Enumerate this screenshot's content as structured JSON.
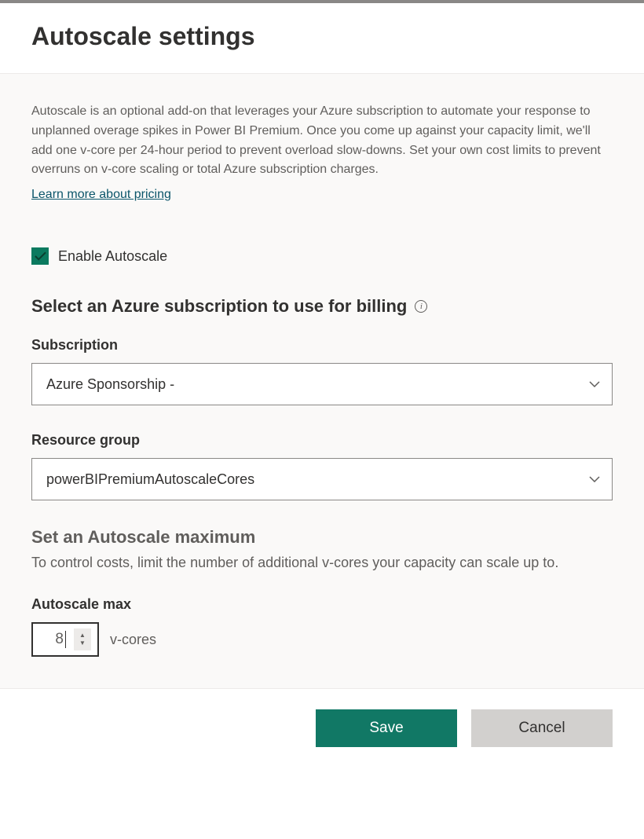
{
  "header": {
    "title": "Autoscale settings"
  },
  "main": {
    "description": "Autoscale is an optional add-on that leverages your Azure subscription to automate your response to unplanned overage spikes in Power BI Premium. Once you come up against your capacity limit, we'll add one v-core per 24-hour period to prevent overload slow-downs. Set your own cost limits to prevent overruns on v-core scaling or total Azure subscription charges.",
    "learn_more": "Learn more about pricing",
    "enable_label": "Enable Autoscale",
    "billing_title": "Select an Azure subscription to use for billing",
    "subscription": {
      "label": "Subscription",
      "value": "Azure Sponsorship -"
    },
    "resource_group": {
      "label": "Resource group",
      "value": "powerBIPremiumAutoscaleCores"
    },
    "max_section": {
      "title": "Set an Autoscale maximum",
      "description": "To control costs, limit the number of additional v-cores your capacity can scale up to.",
      "label": "Autoscale max",
      "value": "8",
      "unit": "v-cores"
    }
  },
  "footer": {
    "save": "Save",
    "cancel": "Cancel"
  }
}
